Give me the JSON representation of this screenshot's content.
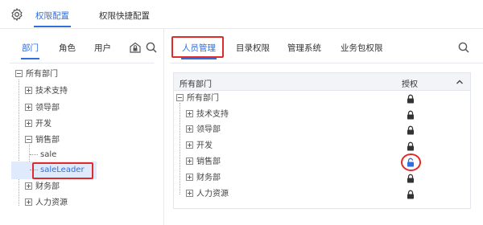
{
  "header": {
    "settings_icon": "gear-icon",
    "tabs": [
      {
        "label": "权限配置",
        "active": true
      },
      {
        "label": "权限快捷配置",
        "active": false
      }
    ]
  },
  "left_panel": {
    "tabs": [
      {
        "label": "部门",
        "active": true
      },
      {
        "label": "角色",
        "active": false
      },
      {
        "label": "用户",
        "active": false
      }
    ],
    "tools": [
      "department-lock-icon",
      "search-icon"
    ],
    "tree": {
      "root": "所有部门",
      "items": [
        {
          "label": "技术支持",
          "expanded": false
        },
        {
          "label": "领导部",
          "expanded": false
        },
        {
          "label": "开发",
          "expanded": false
        },
        {
          "label": "销售部",
          "expanded": true,
          "children": [
            "sale",
            "saleLeader"
          ]
        },
        {
          "label": "财务部",
          "expanded": false
        },
        {
          "label": "人力资源",
          "expanded": false
        }
      ],
      "selected": "saleLeader"
    }
  },
  "right_panel": {
    "tabs": [
      {
        "label": "人员管理",
        "active": true
      },
      {
        "label": "目录权限",
        "active": false
      },
      {
        "label": "管理系统",
        "active": false
      },
      {
        "label": "业务包权限",
        "active": false
      }
    ],
    "search_icon": "search-icon",
    "table": {
      "columns": [
        "所有部门",
        "授权"
      ],
      "collapse_icon": "chevron-up-icon",
      "rows": [
        {
          "label": "所有部门",
          "level": 0,
          "toggle": "minus",
          "auth": "locked"
        },
        {
          "label": "技术支持",
          "level": 1,
          "toggle": "plus",
          "auth": "locked"
        },
        {
          "label": "领导部",
          "level": 1,
          "toggle": "plus",
          "auth": "locked"
        },
        {
          "label": "开发",
          "level": 1,
          "toggle": "plus",
          "auth": "locked"
        },
        {
          "label": "销售部",
          "level": 1,
          "toggle": "plus",
          "auth": "unlocked"
        },
        {
          "label": "财务部",
          "level": 1,
          "toggle": "plus",
          "auth": "locked"
        },
        {
          "label": "人力资源",
          "level": 1,
          "toggle": "plus",
          "auth": "locked"
        }
      ]
    }
  },
  "colors": {
    "accent": "#2f6fe0",
    "highlight": "#e12b2b",
    "selected_bg": "#dfeafc",
    "lock": "#333333"
  }
}
